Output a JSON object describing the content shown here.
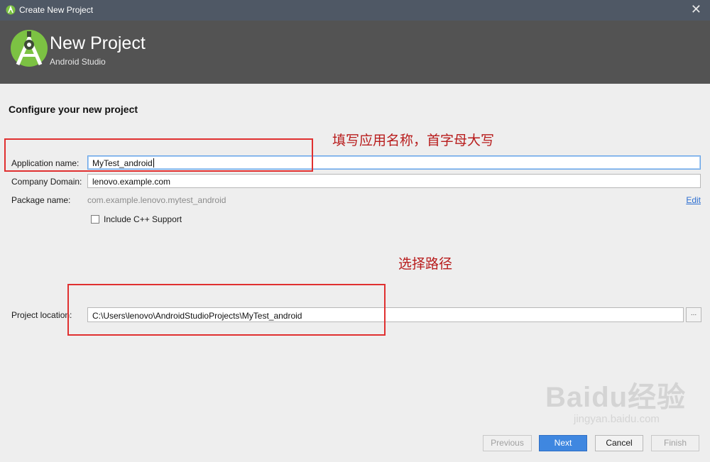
{
  "window": {
    "title": "Create New Project"
  },
  "banner": {
    "title": "New Project",
    "subtitle": "Android Studio"
  },
  "page": {
    "section_title": "Configure your new project"
  },
  "form": {
    "app_name_label": "Application name:",
    "app_name_value": "MyTest_android",
    "company_domain_label": "Company Domain:",
    "company_domain_value": "lenovo.example.com",
    "package_name_label": "Package name:",
    "package_name_value": "com.example.lenovo.mytest_android",
    "edit_link": "Edit",
    "cpp_support_label": "Include C++ Support",
    "cpp_support_checked": false,
    "project_location_label": "Project location:",
    "project_location_value": "C:\\Users\\lenovo\\AndroidStudioProjects\\MyTest_android",
    "browse_button": "..."
  },
  "annotations": {
    "app_name_note": "填写应用名称，首字母大写",
    "location_note": "选择路径"
  },
  "buttons": {
    "previous": "Previous",
    "next": "Next",
    "cancel": "Cancel",
    "finish": "Finish"
  },
  "watermark": {
    "main": "Baidu经验",
    "sub": "jingyan.baidu.com"
  },
  "icons": {
    "app": "android-studio-icon",
    "logo": "android-studio-logo",
    "close": "close-icon"
  },
  "colors": {
    "accent": "#3f87e0",
    "annotation": "#e03030",
    "banner_bg": "#535353",
    "titlebar_bg": "#4f5865"
  }
}
